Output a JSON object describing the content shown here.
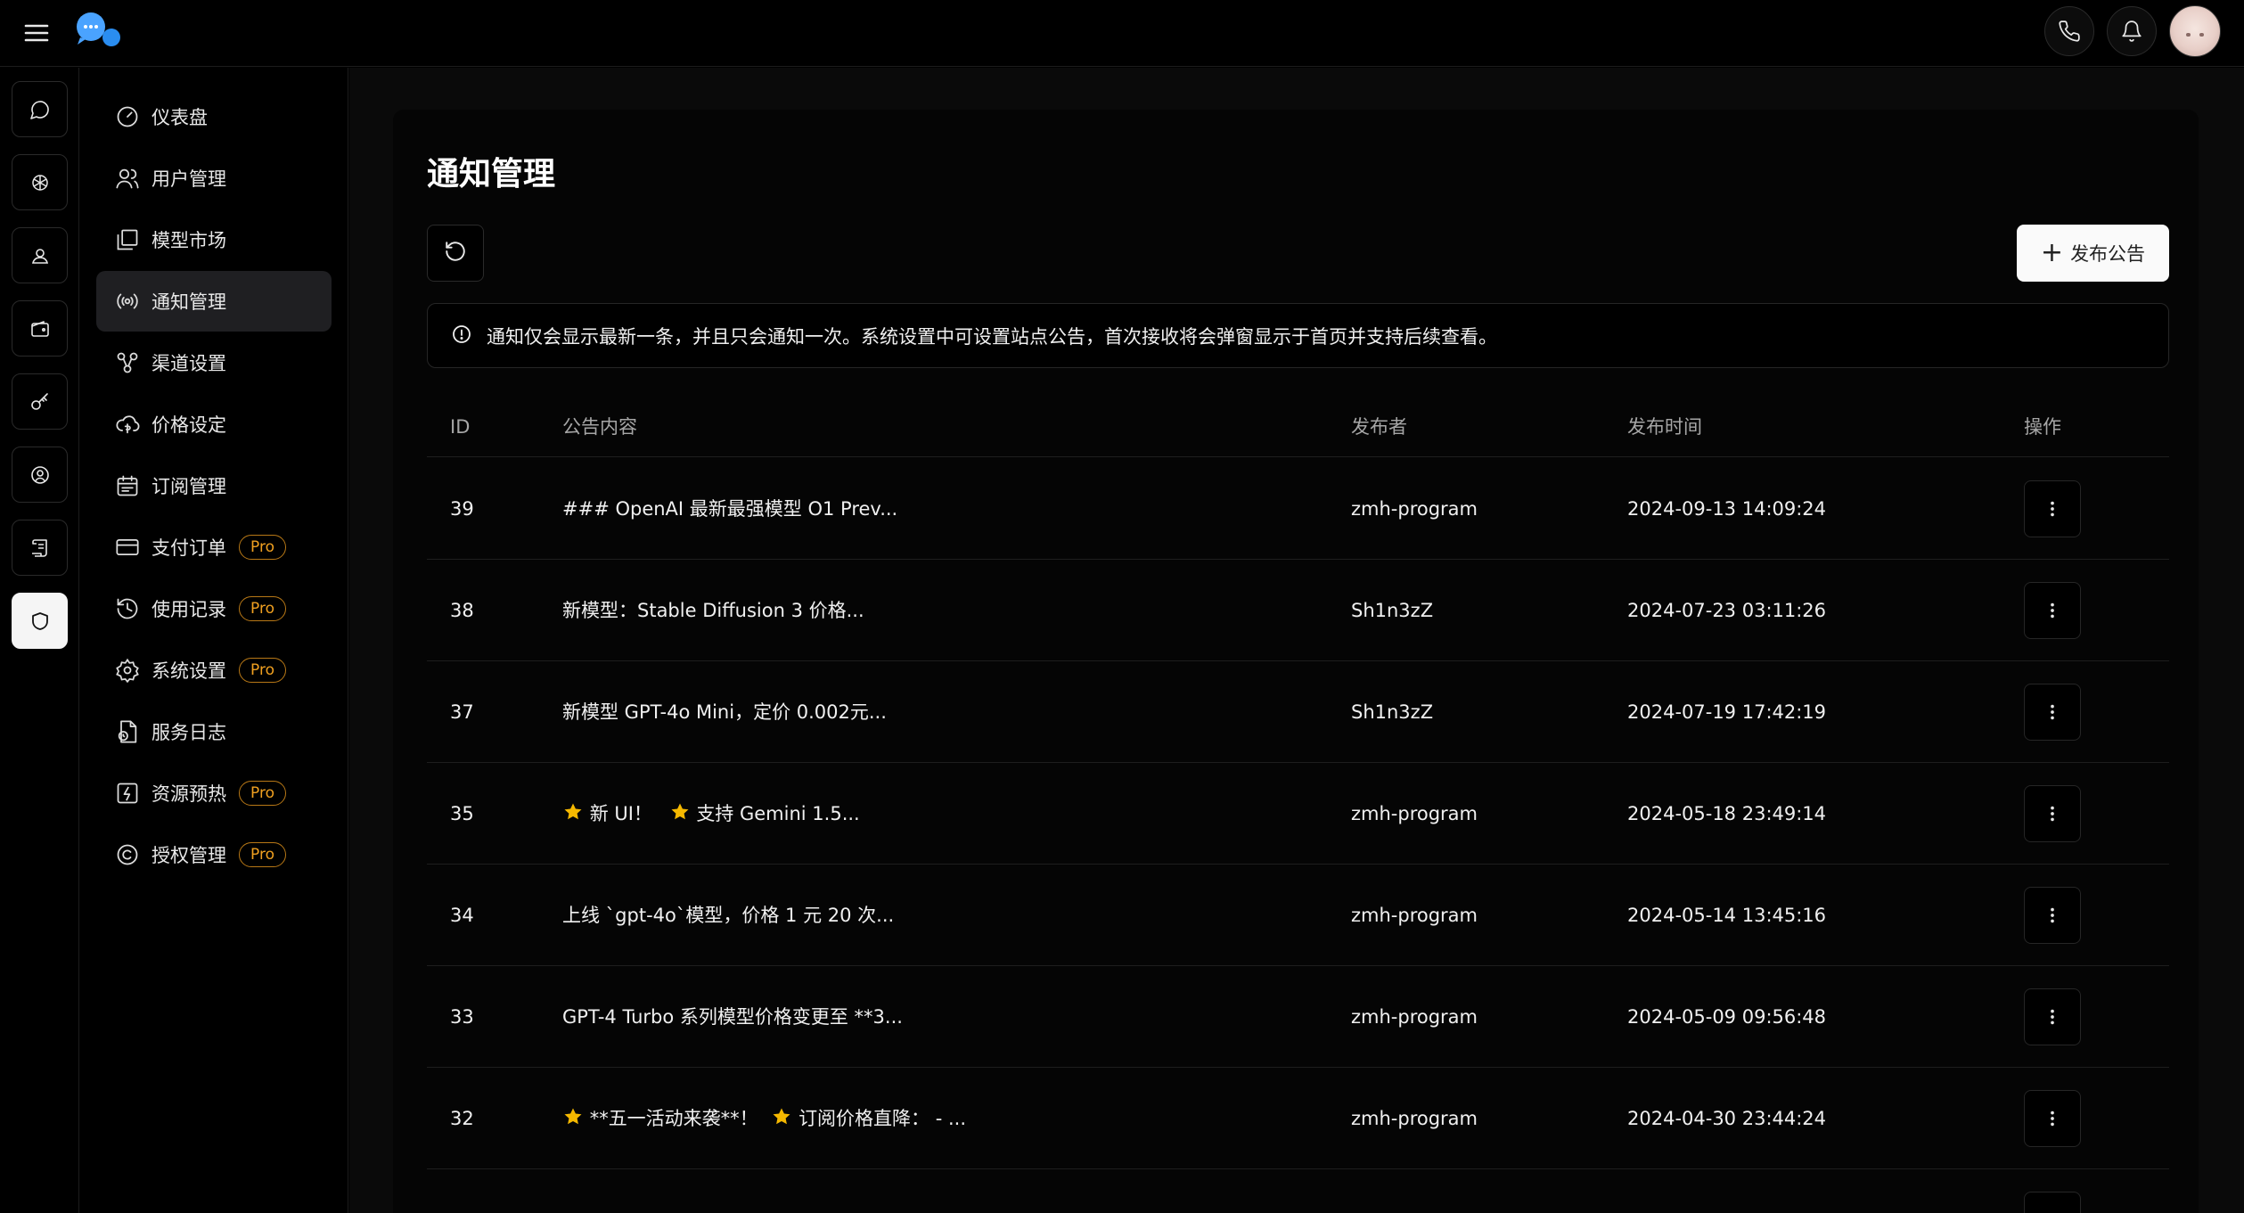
{
  "page": {
    "title": "通知管理"
  },
  "topbar": {
    "icons": [
      "menu-icon",
      "chat-logo-icon",
      "phone-icon",
      "bell-icon",
      "user-avatar"
    ]
  },
  "rail": {
    "icons": [
      "chat-icon",
      "openai-icon",
      "user-icon",
      "wallet-icon",
      "key-icon",
      "user-circle-icon",
      "scroll-icon",
      "shield-icon"
    ],
    "active": "shield-icon"
  },
  "nav": {
    "items": [
      {
        "label": "仪表盘",
        "icon": "gauge-icon"
      },
      {
        "label": "用户管理",
        "icon": "users-icon"
      },
      {
        "label": "模型市场",
        "icon": "gallery-icon"
      },
      {
        "label": "通知管理",
        "icon": "broadcast-icon",
        "active": true
      },
      {
        "label": "渠道设置",
        "icon": "network-icon"
      },
      {
        "label": "价格设定",
        "icon": "cloud-price-icon"
      },
      {
        "label": "订阅管理",
        "icon": "calendar-icon"
      },
      {
        "label": "支付订单",
        "icon": "card-icon",
        "badge": "Pro"
      },
      {
        "label": "使用记录",
        "icon": "history-icon",
        "badge": "Pro"
      },
      {
        "label": "系统设置",
        "icon": "settings-icon",
        "badge": "Pro"
      },
      {
        "label": "服务日志",
        "icon": "log-icon"
      },
      {
        "label": "资源预热",
        "icon": "preheat-icon",
        "badge": "Pro"
      },
      {
        "label": "授权管理",
        "icon": "copyright-icon",
        "badge": "Pro"
      }
    ]
  },
  "toolbar": {
    "publish_label": "发布公告",
    "refresh_icon": "refresh-icon"
  },
  "alert": {
    "text": "通知仅会显示最新一条，并且只会通知一次。系统设置中可设置站点公告，首次接收将会弹窗显示于首页并支持后续查看。"
  },
  "table": {
    "headers": {
      "id": "ID",
      "content": "公告内容",
      "publisher": "发布者",
      "time": "发布时间",
      "action": "操作"
    },
    "rows": [
      {
        "id": "39",
        "content": "### OpenAI 最新最强模型 O1 Prev...",
        "publisher": "zmh-program",
        "time": "2024-09-13 14:09:24"
      },
      {
        "id": "38",
        "content": "新模型：Stable Diffusion 3 价格...",
        "publisher": "Sh1n3zZ",
        "time": "2024-07-23 03:11:26"
      },
      {
        "id": "37",
        "content": "新模型 GPT-4o Mini，定价 0.002元...",
        "publisher": "Sh1n3zZ",
        "time": "2024-07-19 17:42:19"
      },
      {
        "id": "35",
        "content_parts": [
          "新 UI！",
          "支持 Gemini 1.5..."
        ],
        "publisher": "zmh-program",
        "time": "2024-05-18 23:49:14"
      },
      {
        "id": "34",
        "content": "上线 `gpt-4o`模型，价格 1 元 20 次...",
        "publisher": "zmh-program",
        "time": "2024-05-14 13:45:16"
      },
      {
        "id": "33",
        "content": "GPT-4 Turbo 系列模型价格变更至 **3...",
        "publisher": "zmh-program",
        "time": "2024-05-09 09:56:48"
      },
      {
        "id": "32",
        "content_parts": [
          "**五一活动来袭**！",
          "订阅价格直降：  - ..."
        ],
        "publisher": "zmh-program",
        "time": "2024-04-30 23:44:24"
      }
    ]
  },
  "colors": {
    "background": "#000000",
    "accent": "#4aa3ff",
    "pro_badge": "#f0a020",
    "star": "#f5b800"
  }
}
